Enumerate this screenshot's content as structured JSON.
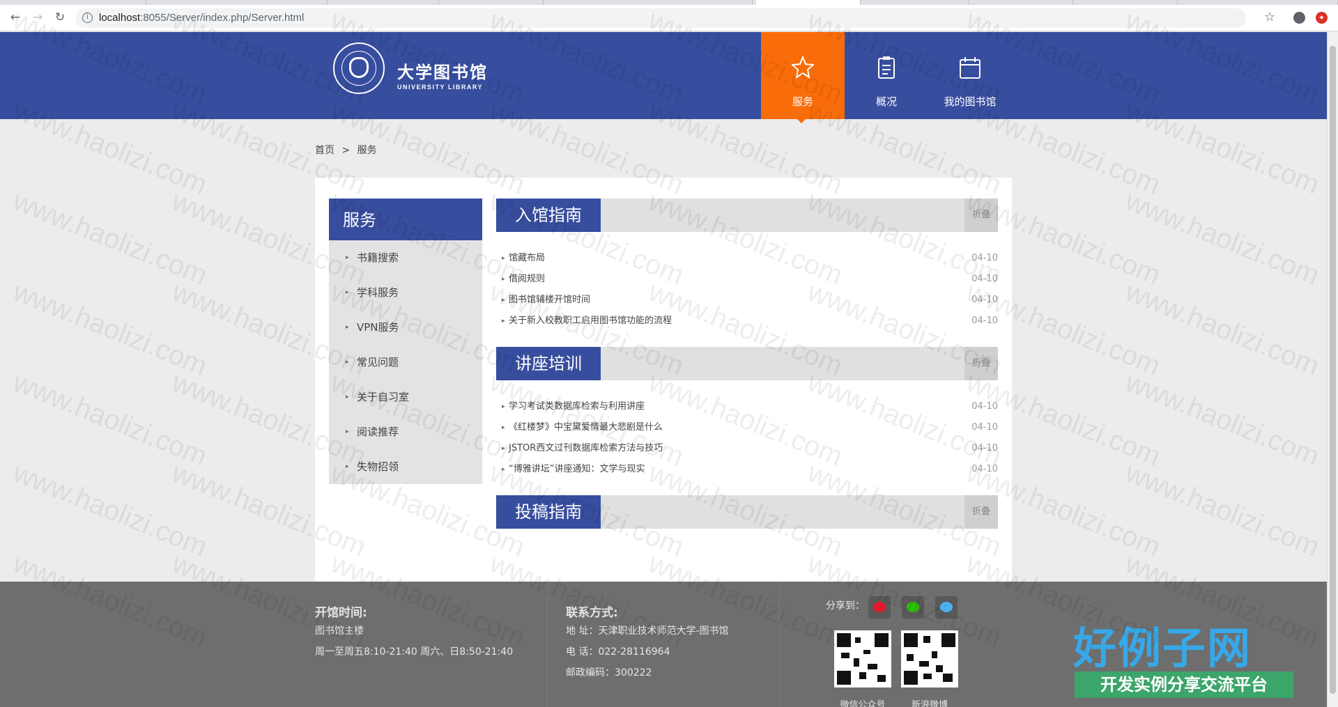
{
  "browser": {
    "url_host": "localhost",
    "url_rest": ":8055/Server/index.php/Server.html"
  },
  "header": {
    "logo_title": "大学图书馆",
    "logo_subtitle": "UNIVERSITY LIBRARY",
    "nav": [
      {
        "label": "服务",
        "icon": "star-icon",
        "active": true
      },
      {
        "label": "概况",
        "icon": "clipboard-icon",
        "active": false
      },
      {
        "label": "我的图书馆",
        "icon": "calendar-icon",
        "active": false
      }
    ],
    "active_color": "#f96c0a",
    "bar_color": "#374d9e"
  },
  "breadcrumb": {
    "home": "首页",
    "separator": ">",
    "current": "服务"
  },
  "sidebar": {
    "title": "服务",
    "items": [
      "书籍搜索",
      "学科服务",
      "VPN服务",
      "常见问题",
      "关于自习室",
      "阅读推荐",
      "失物招领"
    ]
  },
  "sections": [
    {
      "title": "入馆指南",
      "fold_label": "折叠",
      "items": [
        {
          "title": "馆藏布局",
          "date": "04-10"
        },
        {
          "title": "借阅规则",
          "date": "04-10"
        },
        {
          "title": "图书馆辅楼开馆时间",
          "date": "04-10"
        },
        {
          "title": "关于新入校教职工启用图书馆功能的流程",
          "date": "04-10"
        }
      ]
    },
    {
      "title": "讲座培训",
      "fold_label": "折叠",
      "items": [
        {
          "title": "学习考试类数据库检索与利用讲座",
          "date": "04-10"
        },
        {
          "title": "《红楼梦》中宝黛爱情最大悲剧是什么",
          "date": "04-10"
        },
        {
          "title": "JSTOR西文过刊数据库检索方法与技巧",
          "date": "04-10"
        },
        {
          "title": "“博雅讲坛”讲座通知：文学与现实",
          "date": "04-10"
        }
      ]
    },
    {
      "title": "投稿指南",
      "fold_label": "折叠",
      "items": []
    }
  ],
  "footer": {
    "hours_title": "开馆时间:",
    "hours_place": "图书馆主楼",
    "hours_text": "周一至周五8:10-21:40 周六、日8:50-21:40",
    "contact_title": "联系方式:",
    "address": "地 址：天津职业技术师范大学-图书馆",
    "phone": "电 话：022-28116964",
    "postcode": "邮政编码：300222",
    "share_label": "分享到：",
    "share_icons": [
      "weibo-icon",
      "wechat-icon",
      "qq-icon"
    ],
    "qr_labels": [
      "微信公众号",
      "新浪微博"
    ]
  },
  "watermark": "www.haolizi.com",
  "site_badge": {
    "name": "好例子网",
    "tagline": "开发实例分享交流平台"
  }
}
